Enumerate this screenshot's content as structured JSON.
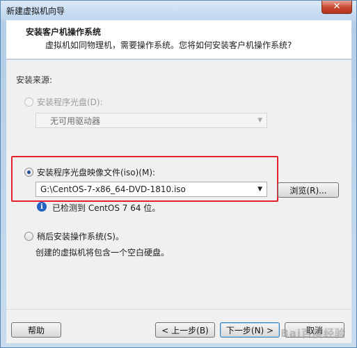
{
  "window": {
    "title": "新建虚拟机向导",
    "close_symbol": "✕"
  },
  "header": {
    "title": "安装客户机操作系统",
    "subtitle": "虚拟机如同物理机，需要操作系统。您将如何安装客户机操作系统?"
  },
  "install_source": {
    "label": "安装来源:",
    "disc_option": {
      "label": "安装程序光盘(D):",
      "selected": false,
      "enabled": false,
      "drive_select_value": "无可用驱动器"
    },
    "iso_option": {
      "label": "安装程序光盘映像文件(iso)(M):",
      "selected": true,
      "path_value": "G:\\CentOS-7-x86_64-DVD-1810.iso",
      "browse_label": "浏览(R)...",
      "info_text": "已检测到 CentOS 7 64 位。",
      "info_icon": "info-icon"
    },
    "later_option": {
      "label": "稍后安装操作系统(S)。",
      "selected": false,
      "description": "创建的虚拟机将包含一个空白硬盘。"
    }
  },
  "footer": {
    "help_label": "帮助",
    "back_label": "< 上一步(B)",
    "next_label": "下一步(N) >",
    "cancel_label": "取消"
  },
  "watermark_text": "Bai百度经验",
  "colors": {
    "highlight_border": "#e5202c",
    "accent_blue": "#2360c1"
  }
}
